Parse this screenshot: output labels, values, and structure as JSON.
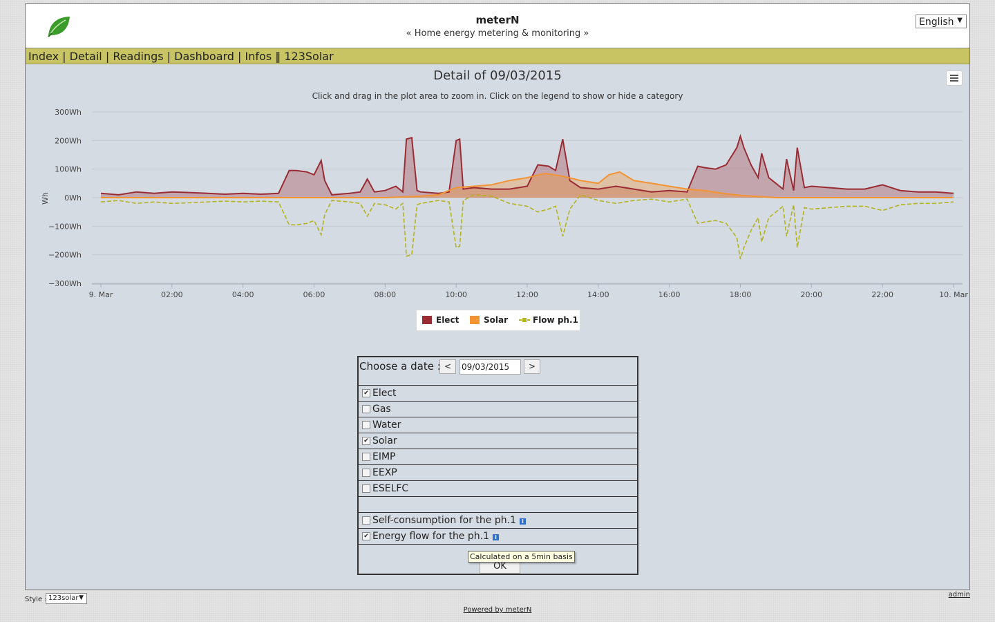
{
  "header": {
    "title": "meterN",
    "subtitle": "« Home energy metering & monitoring »",
    "language": "English"
  },
  "menu": [
    "Index",
    "Detail",
    "Readings",
    "Dashboard",
    "Infos",
    "123Solar"
  ],
  "chart_data": {
    "type": "area",
    "title": "Detail of 09/03/2015",
    "subtitle": "Click and drag in the plot area to zoom in. Click on the legend to show or hide a category",
    "ylabel": "Wh",
    "ylim": [
      -300,
      300
    ],
    "y_ticks": [
      "300Wh",
      "200Wh",
      "100Wh",
      "0Wh",
      "−100Wh",
      "−200Wh",
      "−300Wh"
    ],
    "x_ticks": [
      "9. Mar",
      "02:00",
      "04:00",
      "06:00",
      "08:00",
      "10:00",
      "12:00",
      "14:00",
      "16:00",
      "18:00",
      "20:00",
      "22:00",
      "10. Mar"
    ],
    "x_unit": "hours",
    "series": [
      {
        "name": "Elect",
        "color": "#9a2b33",
        "style": "area",
        "x": [
          0,
          0.5,
          1,
          1.5,
          2,
          2.5,
          3,
          3.5,
          4,
          4.5,
          5,
          5.3,
          5.5,
          5.8,
          6,
          6.2,
          6.3,
          6.5,
          7,
          7.3,
          7.5,
          7.7,
          8,
          8.3,
          8.5,
          8.6,
          8.75,
          8.9,
          9,
          9.5,
          9.8,
          10,
          10.1,
          10.2,
          10.5,
          11,
          11.5,
          12,
          12.3,
          12.6,
          12.8,
          13,
          13.2,
          13.5,
          14,
          14.5,
          15,
          15.5,
          16,
          16.5,
          16.8,
          17,
          17.3,
          17.6,
          17.9,
          18,
          18.1,
          18.3,
          18.5,
          18.6,
          18.8,
          19,
          19.2,
          19.3,
          19.5,
          19.6,
          19.8,
          20,
          20.5,
          21,
          21.5,
          22,
          22.5,
          23,
          23.5,
          24
        ],
        "y": [
          15,
          10,
          20,
          15,
          20,
          18,
          15,
          12,
          15,
          12,
          15,
          95,
          95,
          90,
          80,
          130,
          60,
          10,
          15,
          20,
          65,
          20,
          25,
          40,
          20,
          205,
          210,
          25,
          20,
          15,
          20,
          200,
          205,
          30,
          35,
          30,
          30,
          40,
          115,
          110,
          95,
          205,
          60,
          35,
          30,
          40,
          30,
          20,
          25,
          20,
          110,
          105,
          100,
          115,
          175,
          215,
          175,
          115,
          70,
          155,
          70,
          50,
          30,
          135,
          25,
          175,
          35,
          40,
          35,
          30,
          30,
          45,
          25,
          20,
          20,
          15
        ]
      },
      {
        "name": "Solar",
        "color": "#f39332",
        "style": "line",
        "x": [
          0,
          8,
          9,
          9.5,
          10,
          10.5,
          11,
          11.5,
          12,
          12.5,
          13,
          13.5,
          14,
          14.3,
          14.6,
          15,
          15.5,
          16,
          16.5,
          17,
          17.5,
          18,
          19,
          24
        ],
        "y": [
          0,
          0,
          5,
          10,
          35,
          40,
          45,
          60,
          70,
          85,
          75,
          60,
          50,
          80,
          90,
          60,
          50,
          40,
          30,
          25,
          15,
          8,
          0,
          0
        ]
      },
      {
        "name": "Flow ph.1",
        "color": "#b5b31c",
        "style": "dashed",
        "x": [
          0,
          0.5,
          1,
          1.5,
          2,
          2.5,
          3,
          3.5,
          4,
          4.5,
          5,
          5.3,
          5.5,
          5.8,
          6,
          6.2,
          6.3,
          6.5,
          7,
          7.3,
          7.5,
          7.7,
          8,
          8.3,
          8.5,
          8.6,
          8.75,
          8.9,
          9,
          9.5,
          9.8,
          10,
          10.1,
          10.2,
          10.5,
          11,
          11.5,
          12,
          12.3,
          12.6,
          12.8,
          13,
          13.2,
          13.5,
          14,
          14.5,
          15,
          15.5,
          16,
          16.5,
          16.8,
          17,
          17.3,
          17.6,
          17.9,
          18,
          18.1,
          18.3,
          18.5,
          18.6,
          18.8,
          19,
          19.2,
          19.3,
          19.5,
          19.6,
          19.8,
          20,
          20.5,
          21,
          21.5,
          22,
          22.5,
          23,
          23.5,
          24
        ],
        "y": [
          -15,
          -10,
          -20,
          -15,
          -20,
          -18,
          -15,
          -12,
          -15,
          -12,
          -15,
          -95,
          -95,
          -90,
          -80,
          -130,
          -60,
          -10,
          -15,
          -20,
          -65,
          -20,
          -25,
          -40,
          -20,
          -205,
          -200,
          -25,
          -20,
          -10,
          -15,
          -175,
          -170,
          -10,
          10,
          5,
          -20,
          -30,
          -50,
          -40,
          -30,
          -135,
          -40,
          10,
          -10,
          -20,
          -10,
          -5,
          -15,
          -5,
          -90,
          -85,
          -80,
          -90,
          -140,
          -215,
          -175,
          -115,
          -70,
          -155,
          -70,
          -50,
          -30,
          -135,
          -25,
          -175,
          -35,
          -40,
          -35,
          -30,
          -30,
          -45,
          -25,
          -20,
          -20,
          -15
        ]
      }
    ]
  },
  "form": {
    "date_label": "Choose a date :",
    "prev": "<",
    "date_value": "09/03/2015",
    "next": ">",
    "meters": [
      {
        "label": "Elect",
        "checked": "✔"
      },
      {
        "label": "Gas",
        "checked": ""
      },
      {
        "label": "Water",
        "checked": ""
      },
      {
        "label": "Solar",
        "checked": "✔"
      },
      {
        "label": "EIMP",
        "checked": ""
      },
      {
        "label": "EEXP",
        "checked": ""
      },
      {
        "label": "ESELFC",
        "checked": ""
      }
    ],
    "self_consumption": {
      "label": "Self-consumption for the ph.1",
      "checked": ""
    },
    "energy_flow": {
      "label": "Energy flow for the ph.1",
      "checked": "✔"
    },
    "ok": "OK",
    "tooltip": "Calculated on a 5min basis"
  },
  "footer": {
    "style_label": "Style :",
    "style_value": "123solar",
    "admin": "admin",
    "powered": "Powered by meterN"
  }
}
